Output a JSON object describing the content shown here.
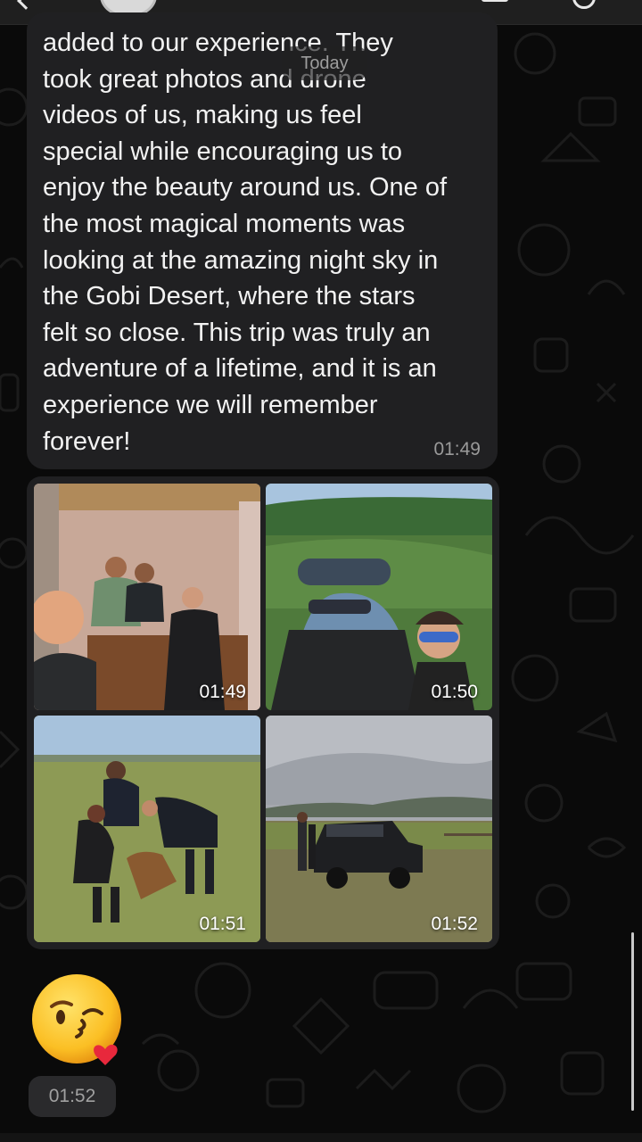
{
  "chat": {
    "date_separator": "Today",
    "messages": [
      {
        "type": "text",
        "text": "added to our experience. They\ntook great photos and drone\nvideos of us, making us feel\nspecial while encouraging us to\nenjoy the beauty around us. One of\nthe most magical moments was\nlooking at the amazing night sky in\nthe Gobi Desert, where the stars\nfelt so close. This trip was truly an\nadventure of a lifetime, and it is an\nexperience we will remember\nforever!",
        "time": "01:49"
      },
      {
        "type": "album",
        "photos": [
          {
            "subject": "group selfie indoors",
            "time": "01:49"
          },
          {
            "subject": "selfie in forested mountains",
            "time": "01:50"
          },
          {
            "subject": "people petting a dog on the steppe",
            "time": "01:51"
          },
          {
            "subject": "black SUV on grassland",
            "time": "01:52"
          }
        ]
      },
      {
        "type": "emoji",
        "emoji": "😘",
        "icon": "face-blowing-kiss-emoji",
        "time": "01:52"
      }
    ]
  },
  "colors": {
    "background": "#0a0a0a",
    "bubble": "#202022",
    "text": "#f2f2f2",
    "timestamp": "#9a9a9a"
  }
}
